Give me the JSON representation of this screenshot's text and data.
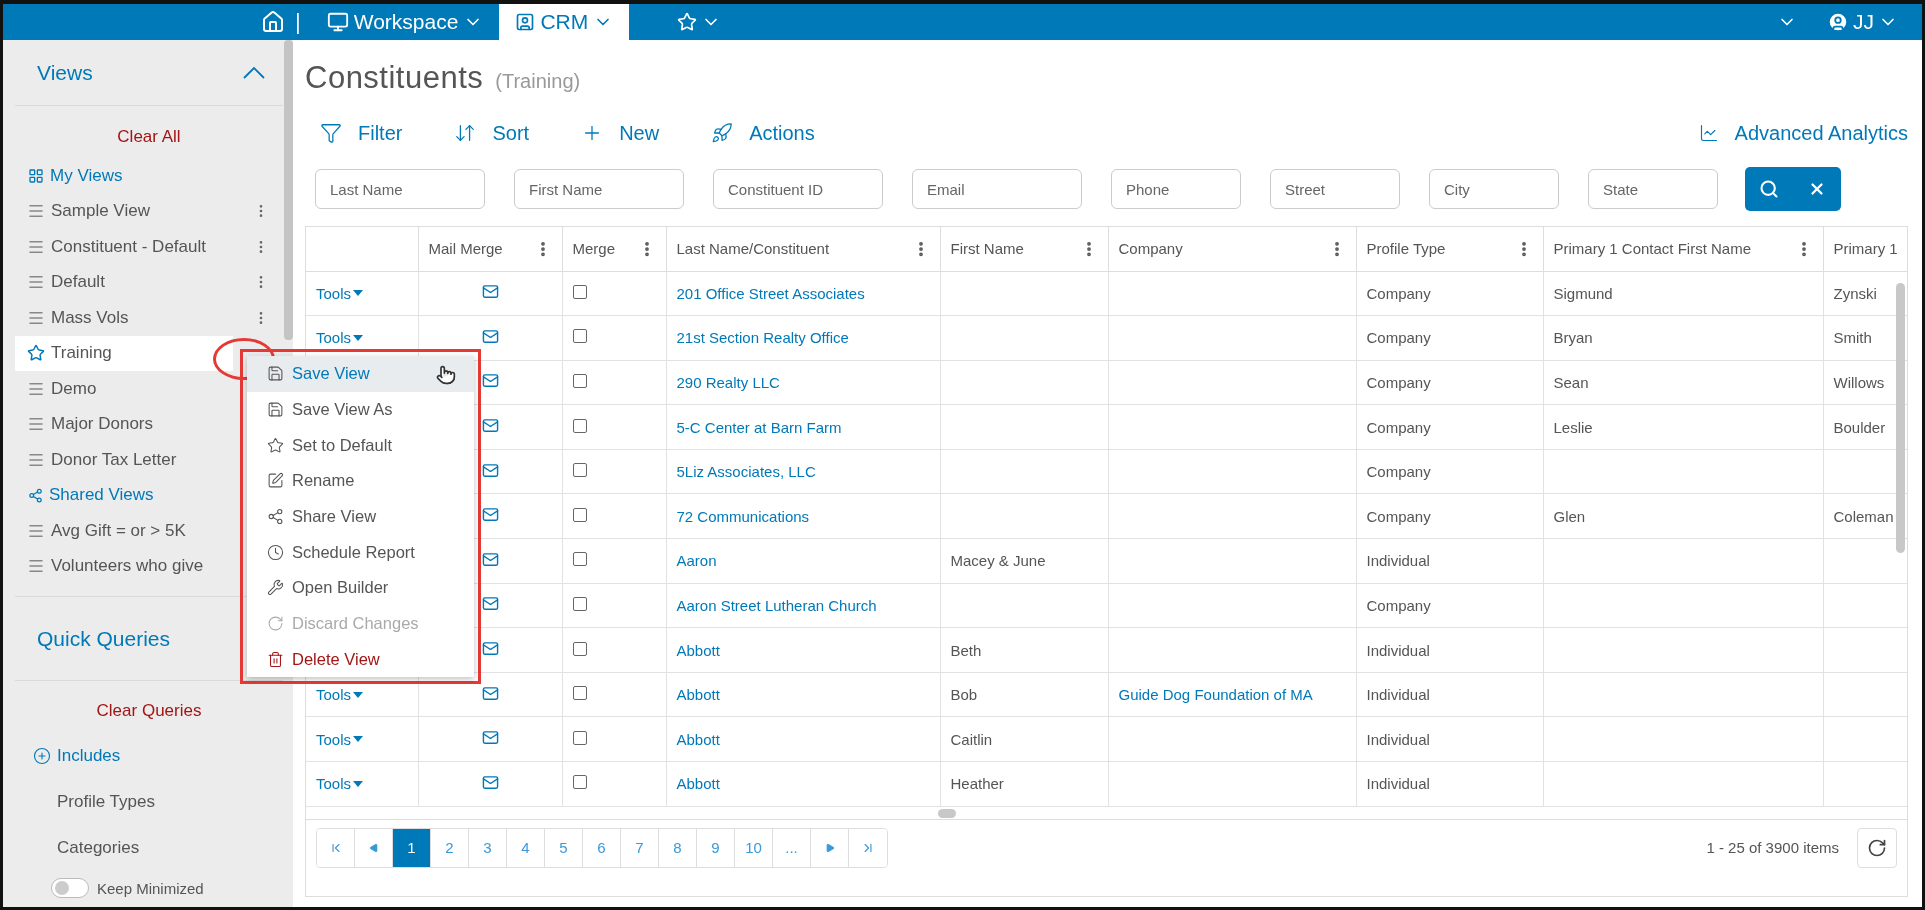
{
  "topbar": {
    "separator": "|",
    "nav": [
      {
        "label": "Workspace",
        "selected": false
      },
      {
        "label": "CRM",
        "selected": true
      }
    ],
    "user": "JJ"
  },
  "sidebar": {
    "views_title": "Views",
    "views_expanded": true,
    "clear_all": "Clear All",
    "items": [
      {
        "kind": "group",
        "label": "My Views",
        "selected": false,
        "menu_dots": false
      },
      {
        "kind": "view",
        "label": "Sample View",
        "selected": false,
        "menu_dots": true
      },
      {
        "kind": "view",
        "label": "Constituent - Default",
        "selected": false,
        "menu_dots": true
      },
      {
        "kind": "view",
        "label": "Default",
        "selected": false,
        "menu_dots": true
      },
      {
        "kind": "view",
        "label": "Mass Vols",
        "selected": false,
        "menu_dots": true
      },
      {
        "kind": "view",
        "label": "Training",
        "selected": true,
        "menu_dots": false
      },
      {
        "kind": "view",
        "label": "Demo",
        "selected": false,
        "menu_dots": false
      },
      {
        "kind": "view",
        "label": "Major Donors",
        "selected": false,
        "menu_dots": false
      },
      {
        "kind": "view",
        "label": "Donor Tax Letter",
        "selected": false,
        "menu_dots": false
      },
      {
        "kind": "group",
        "label": "Shared Views",
        "selected": false,
        "menu_dots": false
      },
      {
        "kind": "view",
        "label": "Avg Gift = or > 5K",
        "selected": false,
        "menu_dots": false
      },
      {
        "kind": "view",
        "label": "Volunteers who give",
        "selected": false,
        "menu_dots": false
      }
    ],
    "queries_title": "Quick Queries",
    "clear_queries": "Clear Queries",
    "query_items": [
      {
        "kind": "add",
        "label": "Includes"
      },
      {
        "kind": "plain",
        "label": "Profile Types"
      },
      {
        "kind": "plain",
        "label": "Categories"
      }
    ],
    "keep_minimized": {
      "label": "Keep Minimized",
      "on": false
    }
  },
  "page": {
    "title": "Constituents",
    "subtitle": "(Training)"
  },
  "toolbar": [
    "Filter",
    "Sort",
    "New",
    "Actions"
  ],
  "analytics": "Advanced Analytics",
  "filters": [
    {
      "placeholder": "Last Name"
    },
    {
      "placeholder": "First Name"
    },
    {
      "placeholder": "Constituent ID"
    },
    {
      "placeholder": "Email"
    },
    {
      "placeholder": "Phone"
    },
    {
      "placeholder": "Street"
    },
    {
      "placeholder": "City"
    },
    {
      "placeholder": "State"
    }
  ],
  "table": {
    "columns": [
      {
        "menu": false
      },
      {
        "label": "Mail Merge",
        "menu": true
      },
      {
        "label": "Merge",
        "menu": true
      },
      {
        "label": "Last Name/Constituent",
        "menu": true
      },
      {
        "label": "First Name",
        "menu": true
      },
      {
        "label": "Company",
        "menu": true
      },
      {
        "label": "Profile Type",
        "menu": true
      },
      {
        "label": "Primary 1 Contact First Name",
        "menu": true
      },
      {
        "label": "Primary 1"
      }
    ],
    "rows": [
      {
        "tools": "Tools",
        "checked": false,
        "last_name": "201 Office Street Associates",
        "first_name": "",
        "company": "",
        "profile_type": "Company",
        "contact_first": "Sigmund",
        "primary_1": "Zynski"
      },
      {
        "tools": "Tools",
        "checked": false,
        "last_name": "21st Section Realty Office",
        "first_name": "",
        "company": "",
        "profile_type": "Company",
        "contact_first": "Bryan",
        "primary_1": "Smith"
      },
      {
        "checked": false,
        "last_name": "290 Realty LLC",
        "first_name": "",
        "company": "",
        "profile_type": "Company",
        "contact_first": "Sean",
        "primary_1": "Willows"
      },
      {
        "checked": false,
        "last_name": "5-C Center at Barn Farm",
        "first_name": "",
        "company": "",
        "profile_type": "Company",
        "contact_first": "Leslie",
        "primary_1": "Boulder"
      },
      {
        "checked": false,
        "last_name": "5Liz Associates, LLC",
        "first_name": "",
        "company": "",
        "profile_type": "Company",
        "contact_first": "",
        "primary_1": ""
      },
      {
        "checked": false,
        "last_name": "72 Communications",
        "first_name": "",
        "company": "",
        "profile_type": "Company",
        "contact_first": "Glen",
        "primary_1": "Coleman"
      },
      {
        "checked": false,
        "last_name": "Aaron",
        "first_name": "Macey & June",
        "company": "",
        "profile_type": "Individual",
        "contact_first": "",
        "primary_1": ""
      },
      {
        "checked": false,
        "last_name": "Aaron Street Lutheran Church",
        "first_name": "",
        "company": "",
        "profile_type": "Company",
        "contact_first": "",
        "primary_1": ""
      },
      {
        "checked": false,
        "last_name": "Abbott",
        "first_name": "Beth",
        "company": "",
        "profile_type": "Individual",
        "contact_first": "",
        "primary_1": ""
      },
      {
        "tools": "Tools",
        "checked": false,
        "last_name": "Abbott",
        "first_name": "Bob",
        "company": "Guide Dog Foundation of MA",
        "profile_type": "Individual",
        "contact_first": "",
        "primary_1": ""
      },
      {
        "tools": "Tools",
        "checked": false,
        "last_name": "Abbott",
        "first_name": "Caitlin",
        "company": "",
        "profile_type": "Individual",
        "contact_first": "",
        "primary_1": ""
      },
      {
        "tools": "Tools",
        "checked": false,
        "last_name": "Abbott",
        "first_name": "Heather",
        "company": "",
        "profile_type": "Individual",
        "contact_first": "",
        "primary_1": ""
      }
    ]
  },
  "pagination": {
    "pages": [
      {
        "label": "1",
        "selected": true
      },
      {
        "label": "2",
        "selected": false
      },
      {
        "label": "3",
        "selected": false
      },
      {
        "label": "4",
        "selected": false
      },
      {
        "label": "5",
        "selected": false
      },
      {
        "label": "6",
        "selected": false
      },
      {
        "label": "7",
        "selected": false
      },
      {
        "label": "8",
        "selected": false
      },
      {
        "label": "9",
        "selected": false
      },
      {
        "label": "10",
        "selected": false
      },
      {
        "label": "...",
        "selected": false
      }
    ],
    "summary": "1 - 25 of 3900 items"
  },
  "context_menu": {
    "items": [
      {
        "kind": "normal",
        "label": "Save View",
        "highlighted": true
      },
      {
        "kind": "normal",
        "label": "Save View As",
        "highlighted": false
      },
      {
        "kind": "normal",
        "label": "Set to Default",
        "highlighted": false
      },
      {
        "kind": "normal",
        "label": "Rename",
        "highlighted": false
      },
      {
        "kind": "normal",
        "label": "Share View",
        "highlighted": false
      },
      {
        "kind": "normal",
        "label": "Schedule Report",
        "highlighted": false
      },
      {
        "kind": "normal",
        "label": "Open Builder",
        "highlighted": false
      },
      {
        "kind": "disabled",
        "label": "Discard Changes",
        "highlighted": false
      },
      {
        "kind": "danger",
        "label": "Delete View",
        "highlighted": false
      }
    ]
  }
}
